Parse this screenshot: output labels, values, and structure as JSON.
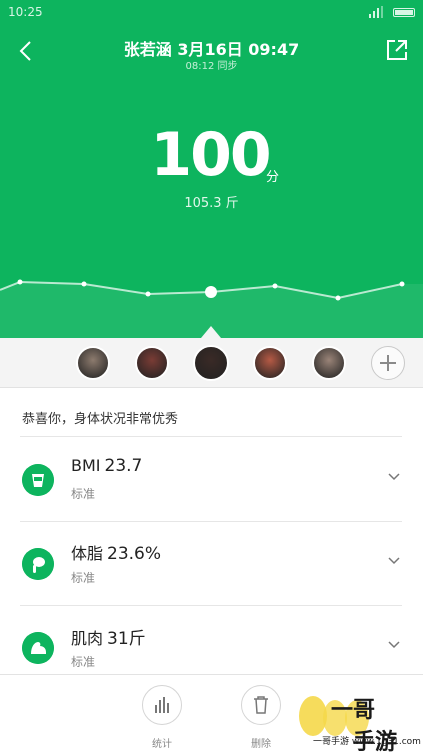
{
  "status_bar": {
    "time": "10:25"
  },
  "header": {
    "title": "张若涵 3月16日 09:47",
    "sync_text": "08:12 同步"
  },
  "score": {
    "value": "100",
    "unit": "分",
    "weight": "105.3 斤"
  },
  "trend": {
    "points": [
      16,
      24,
      22,
      12,
      14,
      20,
      8,
      22
    ]
  },
  "profiles": [
    {
      "name": "profile-1",
      "color": "#8d7b6e"
    },
    {
      "name": "profile-2",
      "color": "#7a3c35"
    },
    {
      "name": "profile-3",
      "color": "#3a2a26",
      "selected": true
    },
    {
      "name": "profile-4",
      "color": "#b55a45"
    },
    {
      "name": "profile-5",
      "color": "#9a8478"
    }
  ],
  "summary": "恭喜你，身体状况非常优秀",
  "metrics": [
    {
      "name": "BMI",
      "value": "23.7",
      "status": "标准",
      "icon": "bmi-icon"
    },
    {
      "name": "体脂",
      "value": "23.6%",
      "status": "标准",
      "icon": "body-fat-icon"
    },
    {
      "name": "肌肉",
      "value": "31斤",
      "status": "标准",
      "icon": "muscle-icon"
    }
  ],
  "toolbar": {
    "stats_label": "统计",
    "delete_label": "删除"
  },
  "watermark": {
    "brand": "一哥",
    "brand2": "手游",
    "site": "一哥手游 www.1g31.com",
    "logo": "1g31"
  },
  "colors": {
    "accent": "#0db45e",
    "background": "#ffffff",
    "strip": "#f4f4f4"
  }
}
